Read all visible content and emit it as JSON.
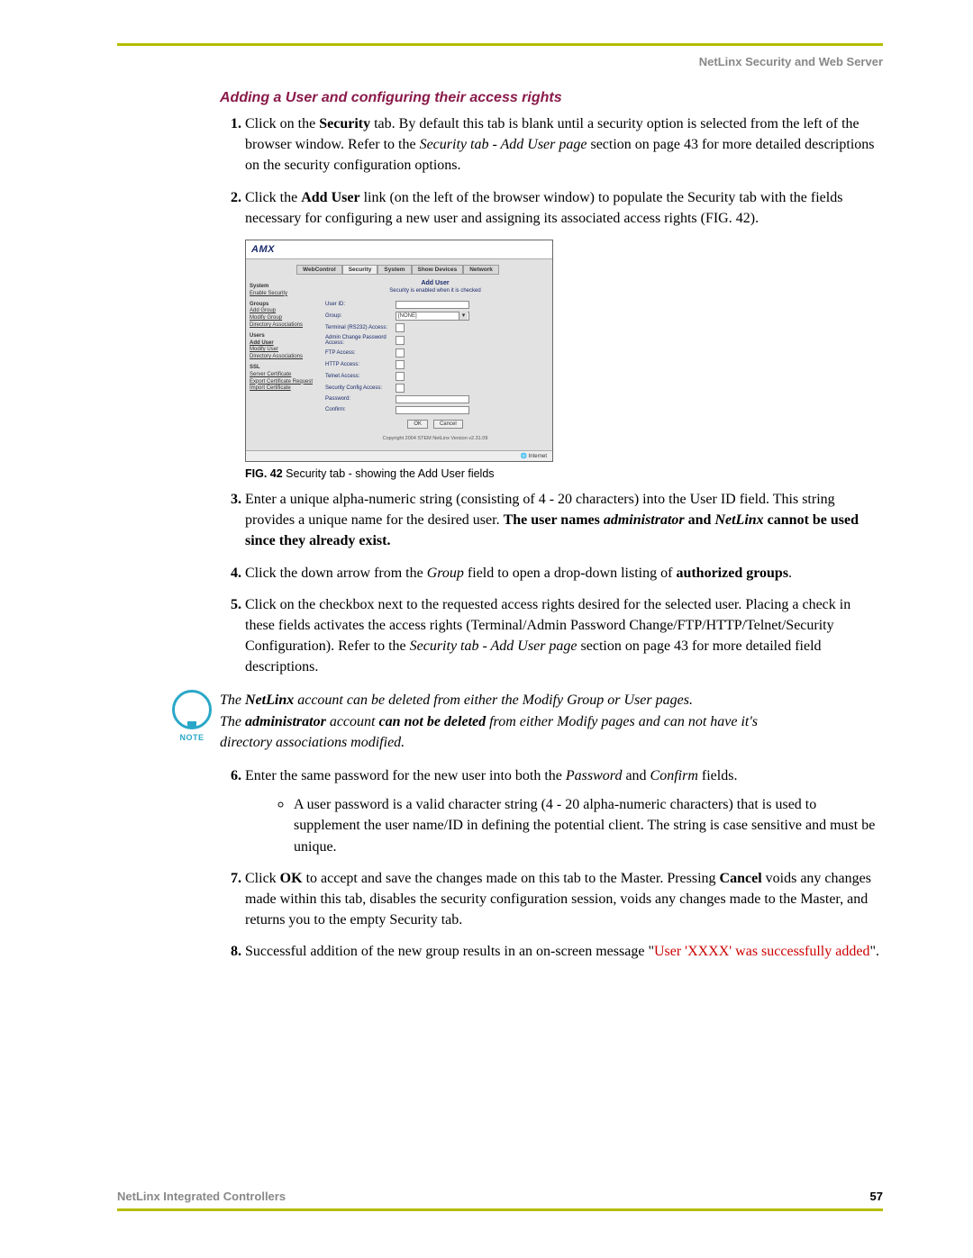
{
  "header": "NetLinx Security and Web Server",
  "section_title": "Adding a User and configuring their access rights",
  "steps": {
    "s1_a": "Click on the ",
    "s1_b": "Security",
    "s1_c": " tab. By default this tab is blank until a security option is selected from the left of the browser window. Refer to the ",
    "s1_d": "Security tab - Add User page",
    "s1_e": " section on page 43 for more detailed descriptions on the security configuration options.",
    "s2_a": "Click the ",
    "s2_b": "Add User",
    "s2_c": " link (on the left of the browser window) to populate the Security tab with the fields necessary for configuring a new user and assigning its associated access rights (FIG. 42).",
    "s3_a": "Enter a unique alpha-numeric string (consisting of 4 - 20 characters) into the User ID field. This string provides a unique name for the desired user. ",
    "s3_b": "The user names ",
    "s3_c": "administrator",
    "s3_d": " and ",
    "s3_e": "NetLinx",
    "s3_f": " cannot be used since they already exist.",
    "s4_a": "Click the down arrow from the ",
    "s4_b": "Group",
    "s4_c": " field to open a drop-down listing of ",
    "s4_d": "authorized groups",
    "s4_e": ".",
    "s5_a": "Click on the checkbox next to the requested access rights desired for the selected user. Placing a check in these fields activates the access rights (Terminal/Admin Password Change/FTP/HTTP/Telnet/Security Configuration). Refer to the ",
    "s5_b": "Security tab - Add User page",
    "s5_c": " section on page 43 for more detailed field descriptions.",
    "s6_a": "Enter the same password for the new user into both the ",
    "s6_b": "Password",
    "s6_c": " and ",
    "s6_d": "Confirm",
    "s6_e": " fields.",
    "sub_a": "A user password is a valid character string (4 - 20 alpha-numeric characters) that is used to supplement the user name/ID in defining the potential client. The string is case sensitive and must be unique.",
    "s7_a": "Click ",
    "s7_b": "OK",
    "s7_c": " to accept and save the changes made on this tab to the Master. Pressing ",
    "s7_d": "Cancel",
    "s7_e": " voids any changes made within this tab, disables the security configuration session, voids any changes made to the Master, and returns you to the empty Security tab.",
    "s8_a": "Successful addition of the new group results in an on-screen message \"",
    "s8_b": "User 'XXXX' was successfully added",
    "s8_c": "\"."
  },
  "note": {
    "label": "NOTE",
    "l1a": "The ",
    "l1b": "NetLinx",
    "l1c": " account can be deleted from either the Modify Group or User pages.",
    "l2a": "The ",
    "l2b": "administrator",
    "l2c": " account ",
    "l2d": "can not be deleted",
    "l2e": " from either Modify pages and can not have it's directory associations modified."
  },
  "figure": {
    "caption_a": "FIG. 42",
    "caption_b": "  Security tab - showing the Add User fields",
    "logo": "AMX",
    "tabs": [
      "WebControl",
      "Security",
      "System",
      "Show Devices",
      "Network"
    ],
    "side": {
      "h1": "System",
      "i1": "Enable Security",
      "h2": "Groups",
      "i2": "Add Group",
      "i3": "Modify Group",
      "i4": "Directory Associations",
      "h3": "Users",
      "i5": "Add User",
      "i6": "Modify User",
      "i7": "Directory Associations",
      "h4": "SSL",
      "i8": "Server Certificate",
      "i9": "Export Certificate Request",
      "i10": "Import Certificate"
    },
    "form": {
      "title": "Add User",
      "sub": "Security is enabled when it is checked",
      "user_id": "User ID:",
      "group": "Group:",
      "group_val": "[NONE]",
      "terminal": "Terminal (RS232) Access:",
      "admin": "Admin Change Password Access:",
      "ftp": "FTP Access:",
      "http": "HTTP Access:",
      "telnet": "Telnet Access:",
      "sec": "Security Config Access:",
      "pwd": "Password:",
      "conf": "Confirm:",
      "ok": "OK",
      "cancel": "Cancel",
      "copy": "Copyright 2004 STEM   NetLinx  Version v2.31.09",
      "status": "Internet"
    }
  },
  "footer": {
    "left": "NetLinx Integrated Controllers",
    "page": "57"
  }
}
